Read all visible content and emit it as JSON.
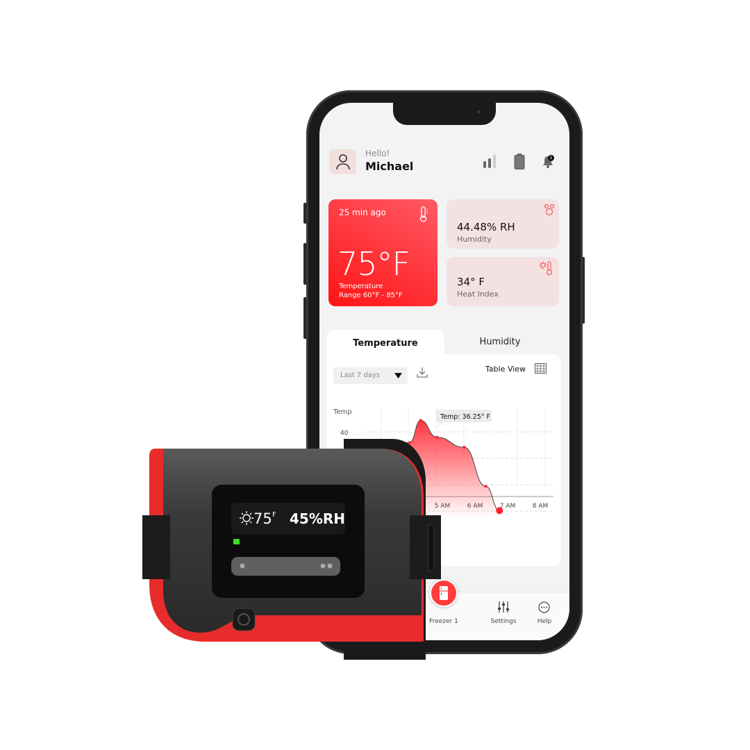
{
  "header": {
    "greeting": "Hello!",
    "user_name": "Michael",
    "notification_count": "1"
  },
  "cards": {
    "temperature": {
      "time_ago": "25 min ago",
      "value": "75°F",
      "label": "Temperature",
      "range": "Range 60°F - 85°F"
    },
    "humidity": {
      "value": "44.48% RH",
      "label": "Humidity"
    },
    "heat_index": {
      "value": "34° F",
      "label": "Heat Index"
    }
  },
  "tabs": [
    {
      "label": "Temperature",
      "active": true
    },
    {
      "label": "Humidity",
      "active": false
    }
  ],
  "controls": {
    "range_select": "Last 7 days",
    "table_view": "Table View"
  },
  "chart_data": {
    "type": "area",
    "ylabel": "Temp",
    "y_ticks": [
      "40"
    ],
    "x_ticks": [
      "5 AM",
      "6 AM",
      "7 AM",
      "8 AM"
    ],
    "tooltip": "Temp: 36.25° F",
    "grid": true,
    "series_color": "#ff1f2a",
    "x": [
      "3:20 AM",
      "4:00 AM",
      "4:20 AM",
      "4:50 AM",
      "5:40 AM",
      "6:20 AM",
      "6:45 AM"
    ],
    "y": [
      37,
      38,
      42.2,
      39,
      37.1,
      29.7,
      25.1
    ]
  },
  "nav": [
    {
      "label": "Freezer 1",
      "icon": "fridge-icon",
      "active": true
    },
    {
      "label": "Settings",
      "icon": "sliders-icon"
    },
    {
      "label": "Help",
      "icon": "more-icon"
    }
  ],
  "device": {
    "temp": "75",
    "temp_unit": "F",
    "humidity": "45%RH",
    "status_led": "#3ddc2a"
  },
  "colors": {
    "accent": "#ff2a2a",
    "card_bg": "#f4e1e1"
  }
}
